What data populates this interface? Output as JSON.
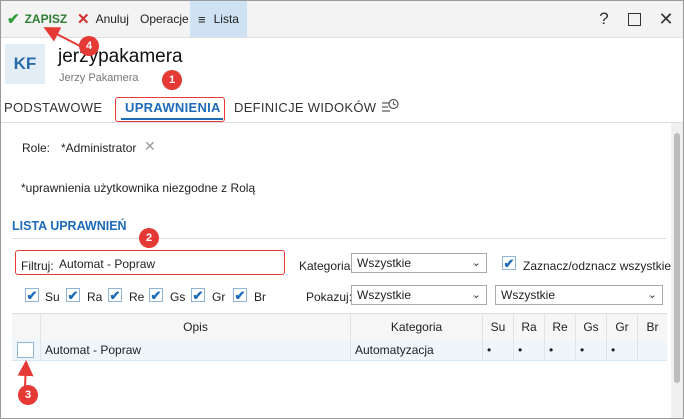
{
  "toolbar": {
    "save_label": "ZAPISZ",
    "cancel_label": "Anuluj",
    "operations_label": "Operacje",
    "list_label": "Lista",
    "save_icon": "✔",
    "cancel_icon": "✕",
    "list_icon": "≡",
    "help_icon": "?",
    "close_icon": "✕"
  },
  "header": {
    "avatar_initials": "KF",
    "login": "jerzypakamera",
    "full_name": "Jerzy Pakamera"
  },
  "tabs": [
    {
      "label": "PODSTAWOWE"
    },
    {
      "label": "UPRAWNIENIA"
    },
    {
      "label": "DEFINICJE WIDOKÓW"
    }
  ],
  "role": {
    "label": "Role:",
    "value": "*Administrator",
    "remove_icon": "✕"
  },
  "note": "*uprawnienia użytkownika niezgodne z Rolą",
  "section_title": "LISTA UPRAWNIEŃ",
  "filter": {
    "label": "Filtruj:",
    "value": "Automat - Popraw",
    "category_label": "Kategoria:",
    "category_value": "Wszystkie",
    "select_all_label": "Zaznacz/odznacz wszystkie",
    "select_all_checked": true,
    "flags": [
      {
        "label": "Su",
        "checked": true
      },
      {
        "label": "Ra",
        "checked": true
      },
      {
        "label": "Re",
        "checked": true
      },
      {
        "label": "Gs",
        "checked": true
      },
      {
        "label": "Gr",
        "checked": true
      },
      {
        "label": "Br",
        "checked": true
      }
    ],
    "show_label": "Pokazuj:",
    "show_value": "Wszystkie",
    "show_value2": "Wszystkie"
  },
  "grid": {
    "columns": [
      "Opis",
      "Kategoria",
      "Su",
      "Ra",
      "Re",
      "Gs",
      "Gr",
      "Br"
    ],
    "rows": [
      {
        "checked": false,
        "opis": "Automat - Popraw",
        "kategoria": "Automatyzacja",
        "su": "•",
        "ra": "•",
        "re": "•",
        "gs": "•",
        "gr": "•",
        "br": ""
      }
    ]
  },
  "annotations": {
    "badges": [
      "1",
      "2",
      "3",
      "4"
    ],
    "accent_color": "#e53935"
  },
  "colors": {
    "brand_blue": "#1e6bb8",
    "save_green": "#2e9e3a",
    "cancel_red": "#d32f2f",
    "selected_tab_bg": "#cfe2f3",
    "row_highlight": "#eef5fb"
  }
}
